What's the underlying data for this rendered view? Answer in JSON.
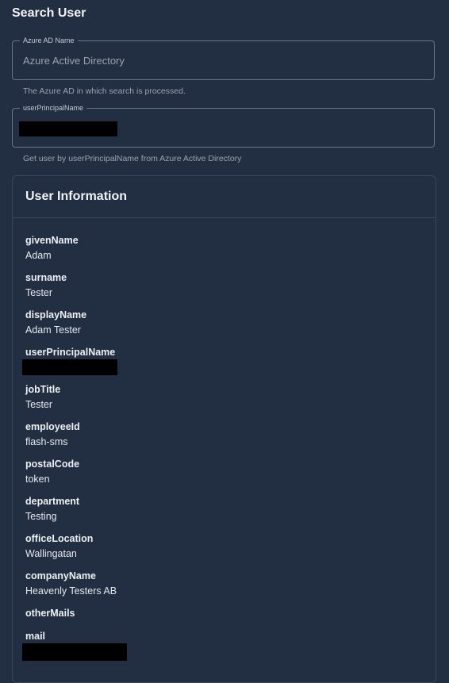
{
  "page": {
    "title": "Search User"
  },
  "form": {
    "azure_ad_name": {
      "label": "Azure AD Name",
      "value": "Azure Active Directory",
      "helper": "The Azure AD in which search is processed."
    },
    "user_principal_name": {
      "label": "userPrincipalName",
      "value": "[redacted]",
      "helper": "Get user by userPrincipalName from Azure Active Directory"
    }
  },
  "user_info": {
    "title": "User Information",
    "fields": [
      {
        "label": "givenName",
        "value": "Adam"
      },
      {
        "label": "surname",
        "value": "Tester"
      },
      {
        "label": "displayName",
        "value": "Adam Tester"
      },
      {
        "label": "userPrincipalName",
        "value": "[redacted]"
      },
      {
        "label": "jobTitle",
        "value": "Tester"
      },
      {
        "label": "employeeId",
        "value": "flash-sms"
      },
      {
        "label": "postalCode",
        "value": "token"
      },
      {
        "label": "department",
        "value": "Testing"
      },
      {
        "label": "officeLocation",
        "value": "Wallingatan"
      },
      {
        "label": "companyName",
        "value": "Heavenly Testers AB"
      },
      {
        "label": "otherMails",
        "value": ""
      },
      {
        "label": "mail",
        "value": "[redacted]"
      }
    ]
  }
}
